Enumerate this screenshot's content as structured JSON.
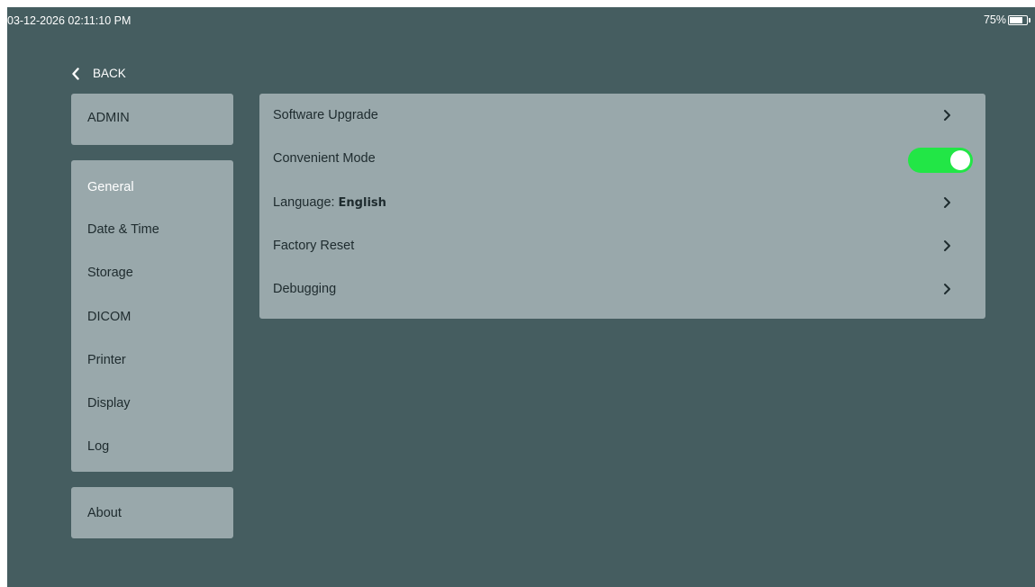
{
  "status": {
    "datetime": "03-12-2026 02:11:10 PM",
    "battery_text": "75%",
    "battery_level": 0.75
  },
  "nav": {
    "back_label": "BACK",
    "back_icon": "chevron-left-icon"
  },
  "sidebar": {
    "admin_label": "ADMIN",
    "items": [
      {
        "label": "General",
        "selected": true
      },
      {
        "label": "Date & Time",
        "selected": false
      },
      {
        "label": "Storage",
        "selected": false
      },
      {
        "label": "DICOM",
        "selected": false
      },
      {
        "label": "Printer",
        "selected": false
      },
      {
        "label": "Display",
        "selected": false
      },
      {
        "label": "Log",
        "selected": false
      }
    ],
    "about_label": "About"
  },
  "settings": {
    "software_upgrade": {
      "label": "Software Upgrade",
      "icon": "chevron-right-icon"
    },
    "convenient_mode": {
      "label": "Convenient Mode",
      "enabled": true
    },
    "language": {
      "label": "Language:",
      "value": "English",
      "icon": "chevron-right-icon"
    },
    "factory_reset": {
      "label": "Factory Reset",
      "icon": "chevron-right-icon"
    },
    "debugging": {
      "label": "Debugging",
      "icon": "chevron-right-icon"
    }
  },
  "colors": {
    "background": "#455d60",
    "panel": "#99a8ab",
    "text_dark": "#1e2b2e",
    "toggle_on": "#22e646",
    "selected_text": "#ffffff"
  }
}
